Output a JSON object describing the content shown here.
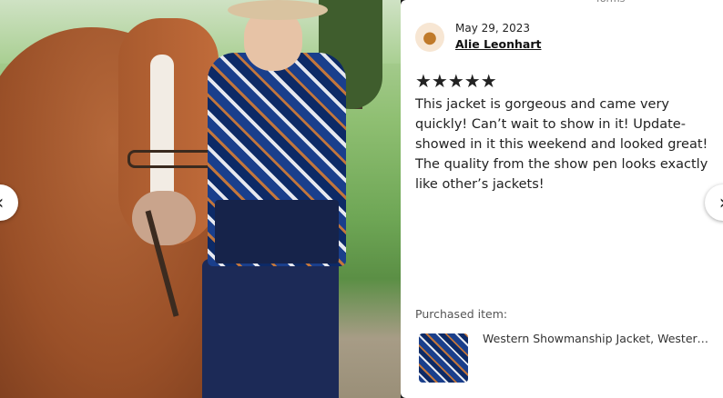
{
  "top_crumb": "forms",
  "review": {
    "date": "May 29, 2023",
    "reviewer": "Alie Leonhart",
    "rating": 5,
    "stars": "★★★★★",
    "text": "This jacket is gorgeous and came very quickly! Can’t wait to show in it! Update- showed in it this weekend and looked great! The quality from the show pen looks exactly like other’s jackets!"
  },
  "purchased": {
    "label": "Purchased item:",
    "item_name": "Western Showmanship Jacket, Western S..."
  },
  "nav": {
    "prev_icon": "chevron-left-icon",
    "next_icon": "chevron-right-icon",
    "prev_glyph": "‹",
    "next_glyph": "›"
  }
}
